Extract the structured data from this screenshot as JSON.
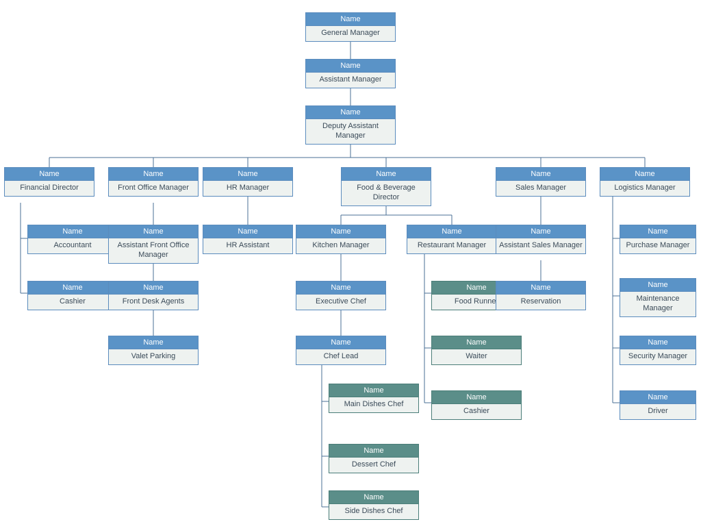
{
  "colors": {
    "blue": "#5a93c7",
    "teal": "#5b8e89",
    "body": "#eef2f0"
  },
  "header_label": "Name",
  "nodes": {
    "gm": {
      "role": "General Manager"
    },
    "am": {
      "role": "Assistant Manager"
    },
    "dam": {
      "role": "Deputy Assistant Manager"
    },
    "fin": {
      "role": "Financial Director"
    },
    "fo": {
      "role": "Front Office Manager"
    },
    "hr": {
      "role": "HR Manager"
    },
    "fb": {
      "role": "Food & Beverage Director"
    },
    "sales": {
      "role": "Sales Manager"
    },
    "log": {
      "role": "Logistics Manager"
    },
    "acct": {
      "role": "Accountant"
    },
    "cashier1": {
      "role": "Cashier"
    },
    "afom": {
      "role": "Assistant Front Office Manager"
    },
    "fda": {
      "role": "Front Desk Agents"
    },
    "valet": {
      "role": "Valet Parking"
    },
    "hrasst": {
      "role": "HR Assistant"
    },
    "kmgr": {
      "role": "Kitchen Manager"
    },
    "rmgr": {
      "role": "Restaurant Manager"
    },
    "asm": {
      "role": "Assistant Sales Manager"
    },
    "resv": {
      "role": "Reservation"
    },
    "pmgr": {
      "role": "Purchase Manager"
    },
    "mmgr": {
      "role": "Maintenance Manager"
    },
    "secmgr": {
      "role": "Security Manager"
    },
    "driver": {
      "role": "Driver"
    },
    "echef": {
      "role": "Executive Chef"
    },
    "clead": {
      "role": "Chef Lead"
    },
    "mdchef": {
      "role": "Main Dishes Chef"
    },
    "dchef": {
      "role": "Dessert Chef"
    },
    "sdchef": {
      "role": "Side Dishes Chef"
    },
    "frunner": {
      "role": "Food Runner"
    },
    "waiter": {
      "role": "Waiter"
    },
    "cashier2": {
      "role": "Cashier"
    }
  }
}
